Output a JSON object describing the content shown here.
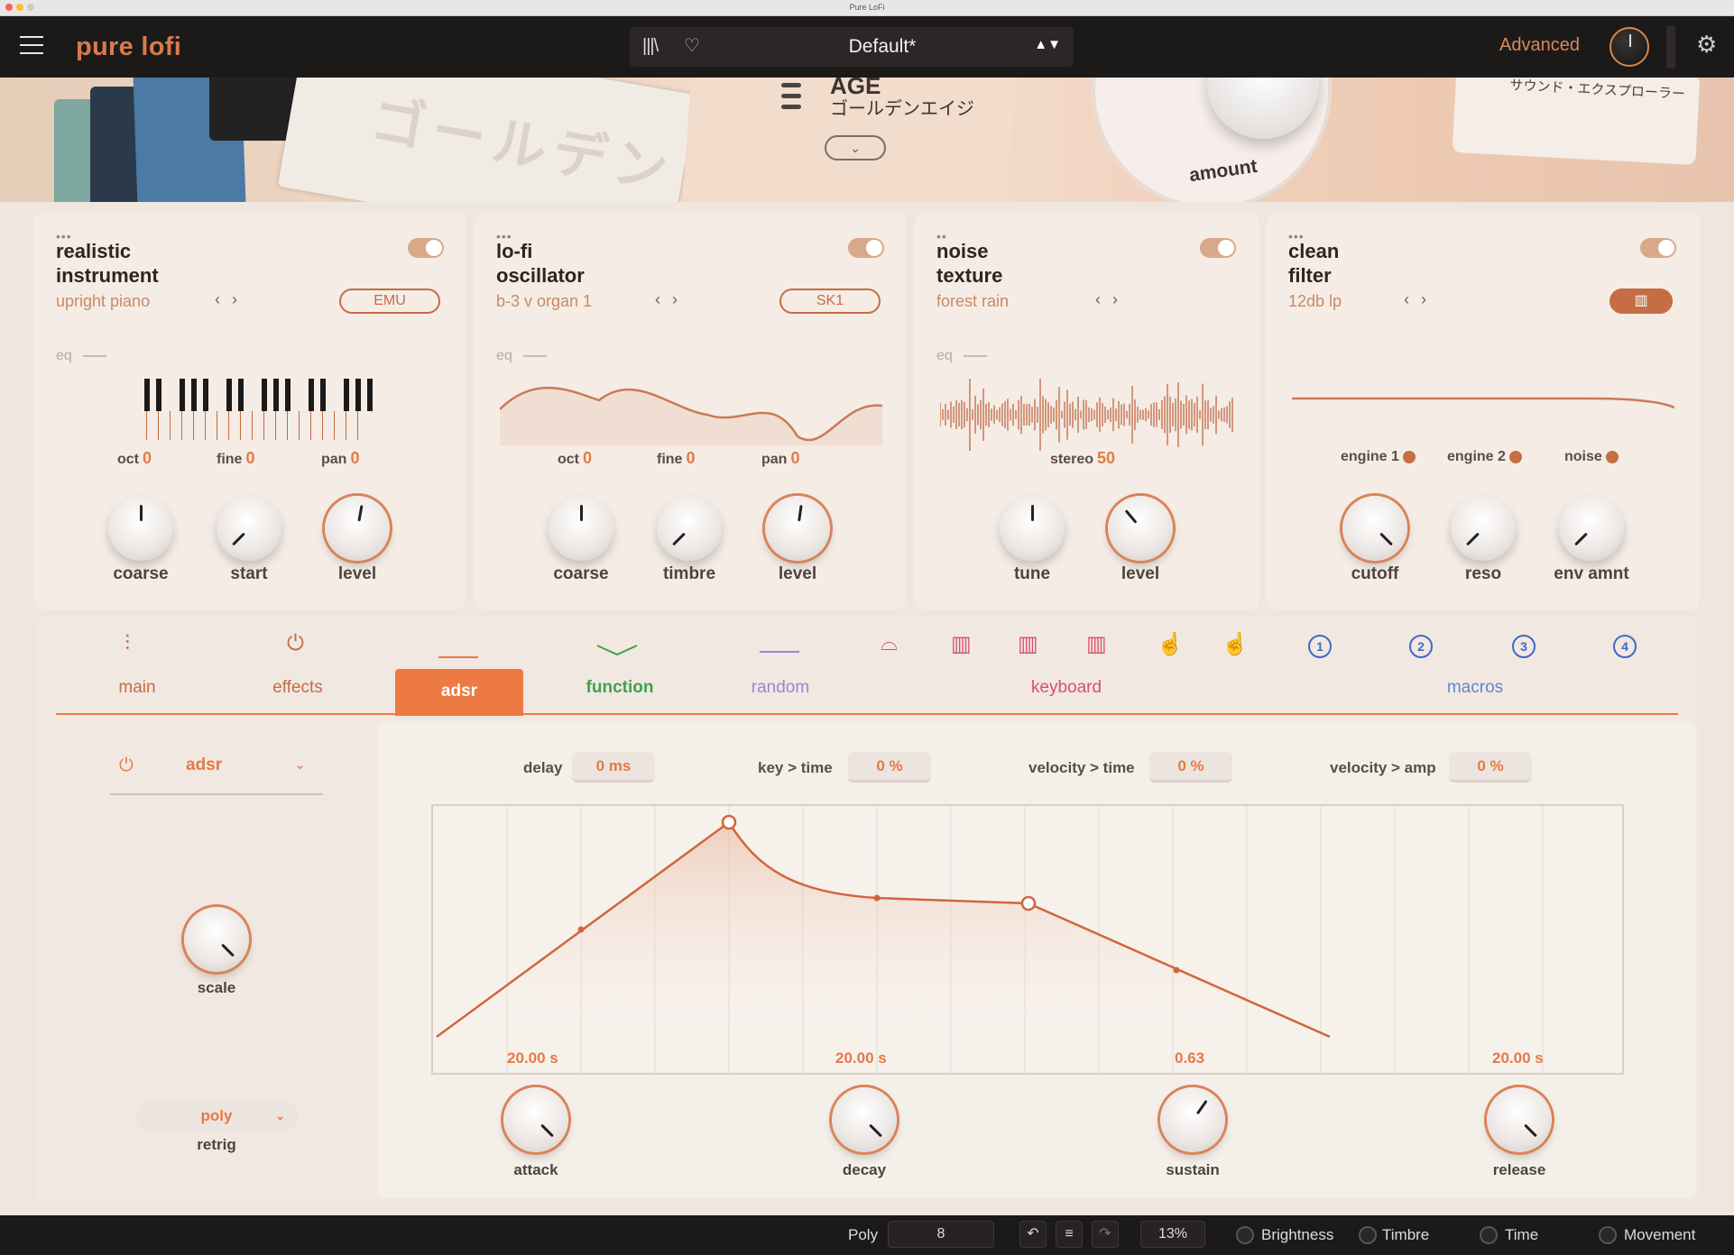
{
  "window": {
    "title": "Pure LoFi"
  },
  "colors": {
    "accent": "#ee7a43",
    "function_green": "#3ea34a",
    "random_purple": "#9a86d9",
    "keyboard_pink": "#d8506c",
    "macros_blue": "#3f69c8"
  },
  "topbar": {
    "brand": "pure lofi",
    "library_icon": "library-icon",
    "favorite_icon": "heart-icon",
    "preset": "Default*",
    "preset_nav": "▲▼",
    "advanced": "Advanced",
    "settings_icon": "gear-icon"
  },
  "banner": {
    "title": "AGE",
    "subtitle": "ゴールデンエイジ",
    "paper_text": "ゴールデン",
    "amount_label": "amount",
    "right_card": "サウンド・エクスプローラー"
  },
  "modules": [
    {
      "title1": "realistic",
      "title2": "instrument",
      "sub": "upright piano",
      "pill": "EMU",
      "enabled": true,
      "eq": "eq",
      "params": [
        {
          "label": "oct",
          "value": "0"
        },
        {
          "label": "fine",
          "value": "0"
        },
        {
          "label": "pan",
          "value": "0"
        }
      ],
      "knobs": [
        "coarse",
        "start",
        "level"
      ]
    },
    {
      "title1": "lo-fi",
      "title2": "oscillator",
      "sub": "b-3 v organ 1",
      "pill": "SK1",
      "enabled": true,
      "eq": "eq",
      "params": [
        {
          "label": "oct",
          "value": "0"
        },
        {
          "label": "fine",
          "value": "0"
        },
        {
          "label": "pan",
          "value": "0"
        }
      ],
      "knobs": [
        "coarse",
        "timbre",
        "level"
      ]
    },
    {
      "title1": "noise",
      "title2": "texture",
      "sub": "forest rain",
      "enabled": true,
      "eq": "eq",
      "params": [
        {
          "label": "stereo",
          "value": "50"
        }
      ],
      "knobs": [
        "tune",
        "level"
      ]
    },
    {
      "title1": "clean",
      "title2": "filter",
      "sub": "12db lp",
      "enabled": true,
      "params": [
        {
          "label": "engine 1"
        },
        {
          "label": "engine 2"
        },
        {
          "label": "noise"
        }
      ],
      "knobs": [
        "cutoff",
        "reso",
        "env amnt"
      ]
    }
  ],
  "tabs": [
    "main",
    "effects",
    "adsr",
    "function",
    "random",
    "keyboard",
    "macros"
  ],
  "active_tab": "adsr",
  "macros": [
    "1",
    "2",
    "3",
    "4"
  ],
  "adsr": {
    "selector": "adsr",
    "scale_label": "scale",
    "retrig_value": "poly",
    "retrig_label": "retrig",
    "params": [
      {
        "label": "delay",
        "value": "0 ms"
      },
      {
        "label": "key > time",
        "value": "0 %"
      },
      {
        "label": "velocity > time",
        "value": "0 %"
      },
      {
        "label": "velocity > amp",
        "value": "0 %"
      }
    ],
    "values": {
      "attack": "20.00 s",
      "decay": "20.00 s",
      "sustain": "0.63",
      "release": "20.00 s"
    },
    "knobs": [
      "attack",
      "decay",
      "sustain",
      "release"
    ]
  },
  "status": {
    "poly_label": "Poly",
    "poly_value": "8",
    "cpu": "13%",
    "macros": [
      "Brightness",
      "Timbre",
      "Time",
      "Movement"
    ]
  }
}
